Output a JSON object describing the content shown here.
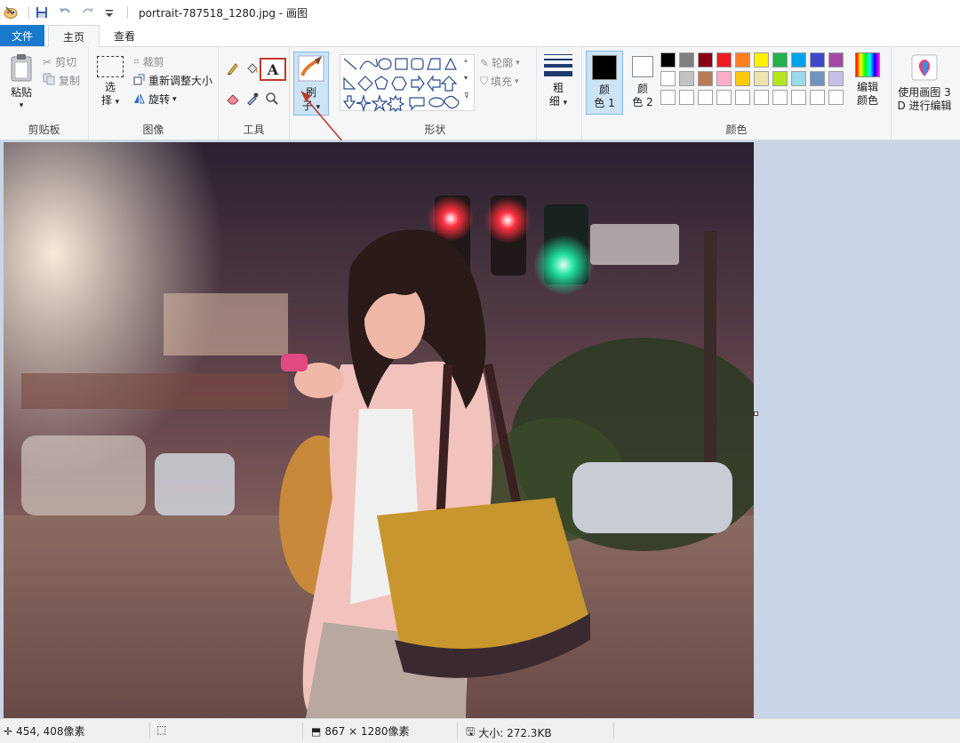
{
  "titlebar": {
    "title": "portrait-787518_1280.jpg - 画图"
  },
  "tabs": {
    "file": "文件",
    "home": "主页",
    "view": "查看"
  },
  "clipboard": {
    "paste": "粘贴",
    "cut": "剪切",
    "copy": "复制",
    "label": "剪贴板"
  },
  "image": {
    "select_top": "选",
    "select_bottom": "择",
    "crop": "裁剪",
    "resize": "重新调整大小",
    "rotate": "旋转",
    "label": "图像"
  },
  "tools": {
    "text_tool": "A",
    "label": "工具"
  },
  "brushes": {
    "top": "刷",
    "bottom": "子"
  },
  "shapes": {
    "outline": "轮廓",
    "fill": "填充",
    "label": "形状"
  },
  "size": {
    "top": "粗",
    "bottom": "细"
  },
  "colors": {
    "color1_top": "颜",
    "color1_bottom": "色 1",
    "color2_top": "颜",
    "color2_bottom": "色 2",
    "edit_top": "编辑",
    "edit_bottom": "颜色",
    "label": "颜色",
    "color1_value": "#000000",
    "color2_value": "#ffffff",
    "palette_row1": [
      "#000000",
      "#7f7f7f",
      "#880015",
      "#ed1c24",
      "#ff7f27",
      "#fff200",
      "#22b14c",
      "#00a2e8",
      "#3f48cc",
      "#a349a4"
    ],
    "palette_row2": [
      "#ffffff",
      "#c3c3c3",
      "#b97a57",
      "#ffaec9",
      "#ffc90e",
      "#efe4b0",
      "#b5e61d",
      "#99d9ea",
      "#7092be",
      "#c8bfe7"
    ],
    "palette_row3": [
      "#ffffff",
      "#ffffff",
      "#ffffff",
      "#ffffff",
      "#ffffff",
      "#ffffff",
      "#ffffff",
      "#ffffff",
      "#ffffff",
      "#ffffff"
    ]
  },
  "paint3d": {
    "line1": "使用画图 3",
    "line2": "D 进行编辑"
  },
  "status": {
    "cursor": "454, 408像素",
    "dimensions": "867 × 1280像素",
    "filesize": "大小: 272.3KB"
  }
}
